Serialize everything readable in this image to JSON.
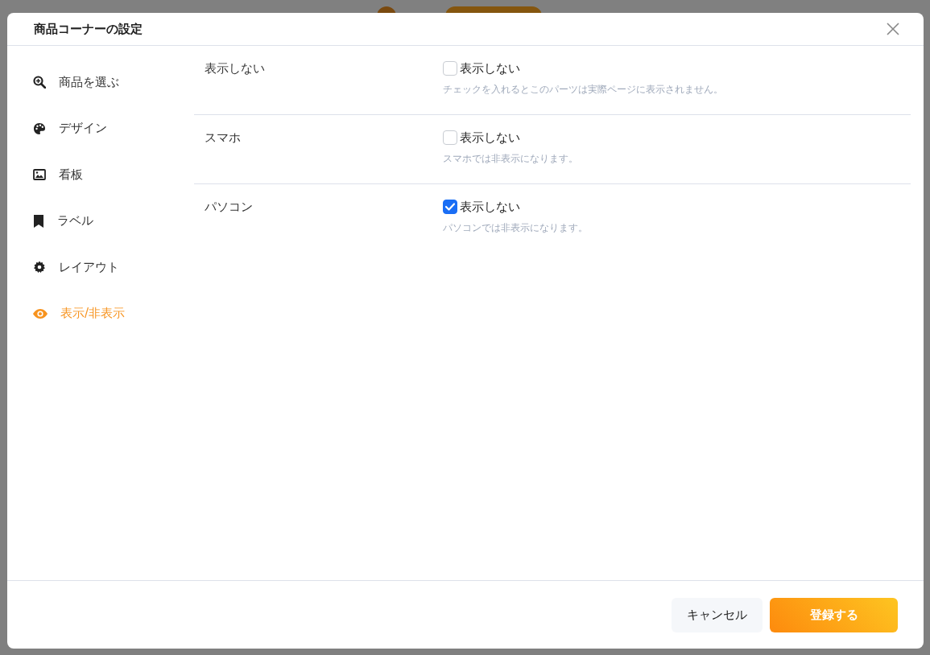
{
  "dialog": {
    "title": "商品コーナーの設定"
  },
  "sidebar": {
    "items": [
      {
        "label": "商品を選ぶ",
        "selected": false
      },
      {
        "label": "デザイン",
        "selected": false
      },
      {
        "label": "看板",
        "selected": false
      },
      {
        "label": "ラベル",
        "selected": false
      },
      {
        "label": "レイアウト",
        "selected": false
      },
      {
        "label": "表示/非表示",
        "selected": true
      }
    ]
  },
  "settings": {
    "rows": [
      {
        "label": "表示しない",
        "checkbox": {
          "label": "表示しない",
          "checked": false
        },
        "hint": "チェックを入れるとこのパーツは実際ページに表示されません。"
      },
      {
        "label": "スマホ",
        "checkbox": {
          "label": "表示しない",
          "checked": false
        },
        "hint": "スマホでは非表示になります。"
      },
      {
        "label": "パソコン",
        "checkbox": {
          "label": "表示しない",
          "checked": true
        },
        "hint": "パソコンでは非表示になります。"
      }
    ]
  },
  "footer": {
    "buttons": [
      {
        "label": "キャンセル",
        "kind": "secondary"
      },
      {
        "label": "登録する",
        "kind": "primary"
      }
    ]
  }
}
